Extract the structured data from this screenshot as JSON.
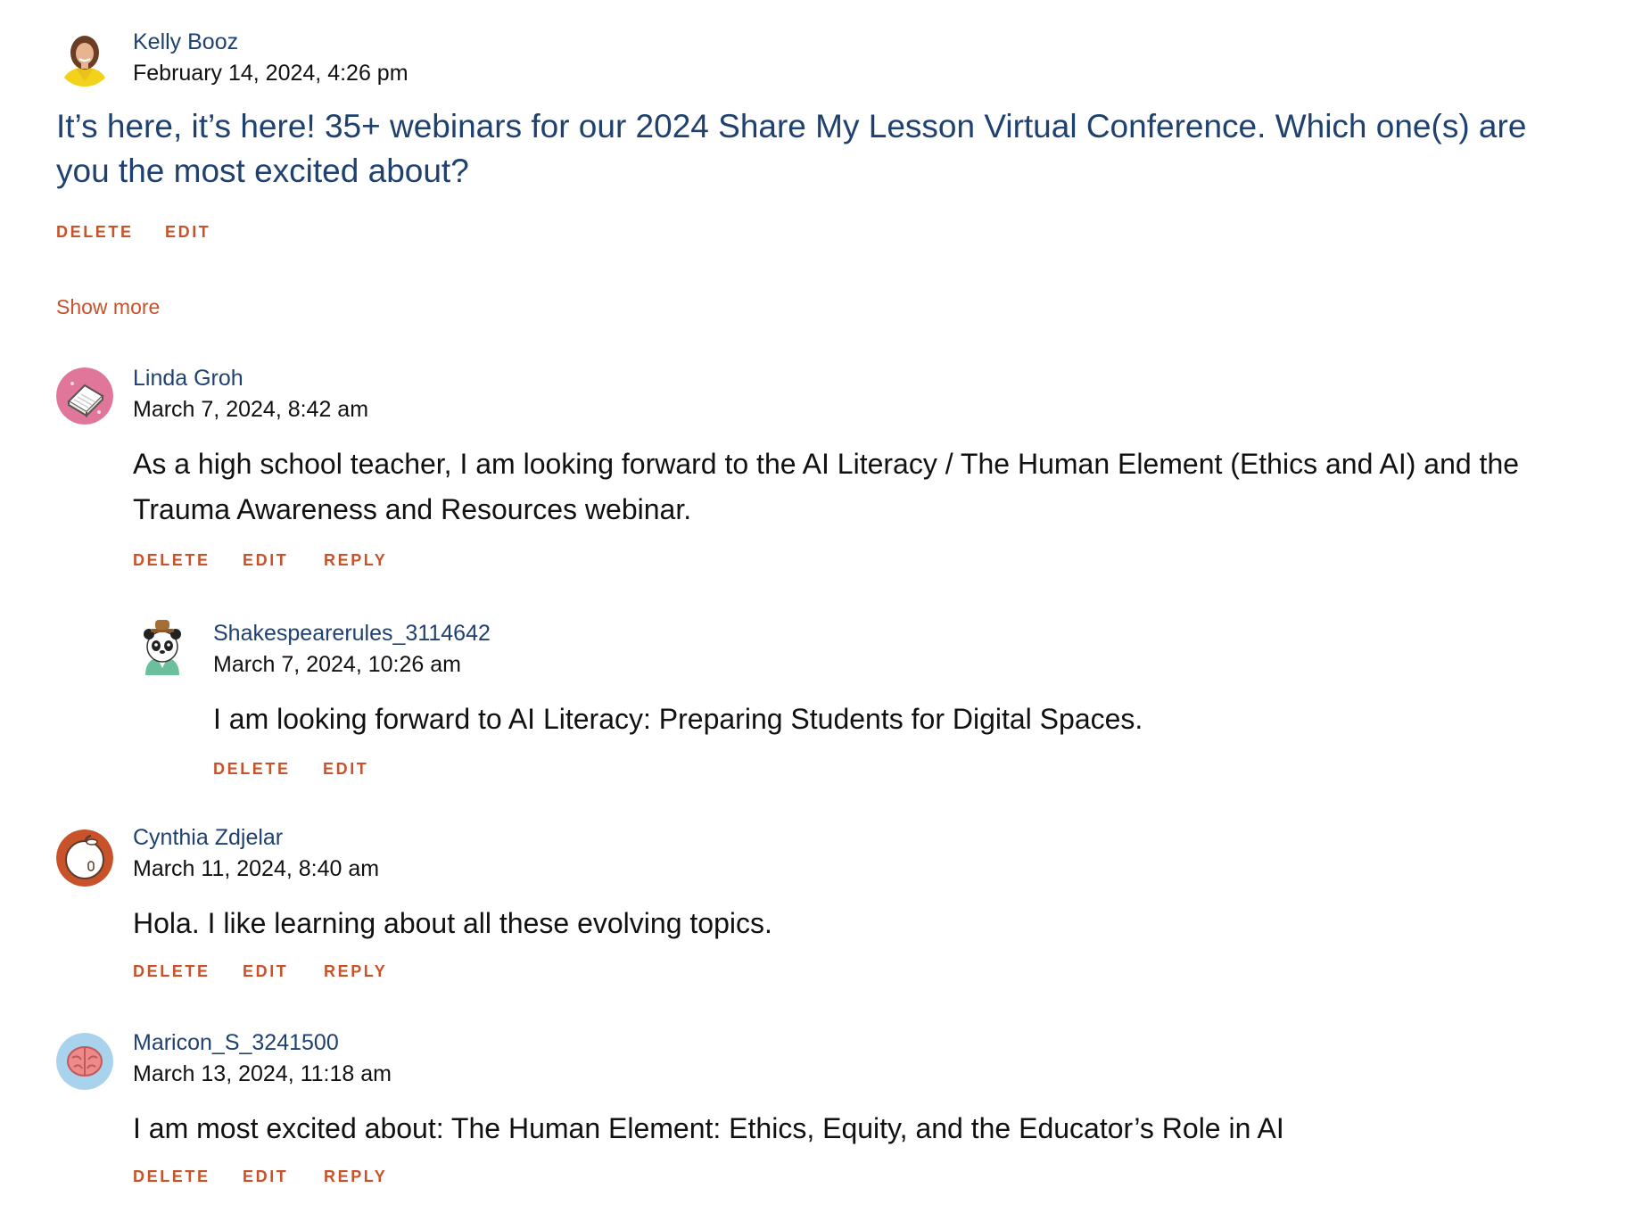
{
  "post": {
    "author": "Kelly Booz",
    "date": "February 14, 2024, 4:26 pm",
    "text": "It’s here, it’s here! 35+ webinars for our 2024 Share My Lesson Virtual Conference. Which one(s) are you the most excited about?",
    "actions": {
      "delete": "DELETE",
      "edit": "EDIT"
    },
    "avatar_icon": "person-photo-icon"
  },
  "show_more": "Show more",
  "comments": [
    {
      "author": "Linda Groh",
      "date": "March 7, 2024, 8:42 am",
      "text": "As a high school teacher, I am looking forward to the AI Literacy / The Human Element (Ethics and AI) and the Trauma Awareness and Resources webinar.",
      "actions": {
        "delete": "DELETE",
        "edit": "EDIT",
        "reply": "REPLY"
      },
      "avatar_icon": "book-avatar-icon"
    },
    {
      "author": "Shakespearerules_3114642",
      "date": "March 7, 2024, 10:26 am",
      "text": "I am looking forward to AI Literacy: Preparing Students for Digital Spaces.",
      "actions": {
        "delete": "DELETE",
        "edit": "EDIT"
      },
      "avatar_icon": "panda-avatar-icon"
    },
    {
      "author": "Cynthia Zdjelar",
      "date": "March 11, 2024, 8:40 am",
      "text": "Hola. I like learning about all these evolving topics.",
      "actions": {
        "delete": "DELETE",
        "edit": "EDIT",
        "reply": "REPLY"
      },
      "avatar_icon": "apple-avatar-icon"
    },
    {
      "author": "Maricon_S_3241500",
      "date": "March 13, 2024, 11:18 am",
      "text": "I am most excited about: The Human Element: Ethics, Equity, and the Educator’s Role in AI",
      "actions": {
        "delete": "DELETE",
        "edit": "EDIT",
        "reply": "REPLY"
      },
      "avatar_icon": "brain-avatar-icon"
    }
  ],
  "colors": {
    "author_link": "#1f4170",
    "action": "#c8532a",
    "text": "#111111"
  }
}
